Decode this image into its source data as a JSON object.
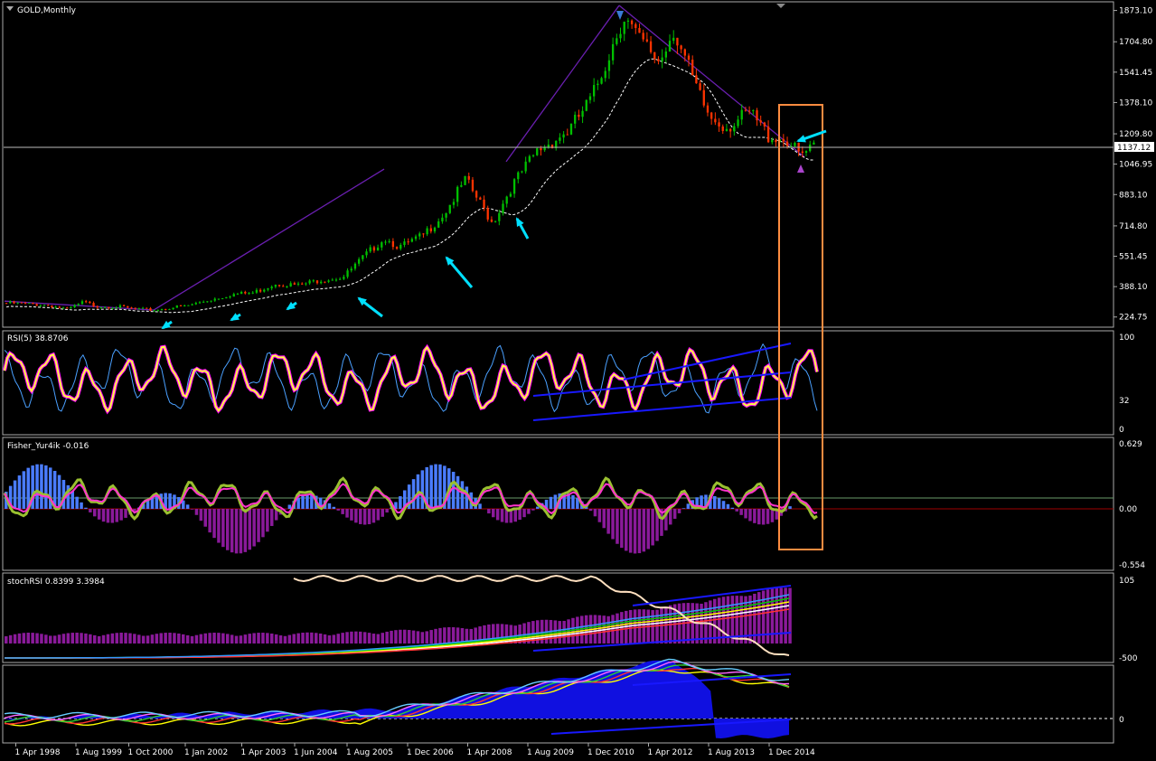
{
  "chart_data": {
    "type": "line",
    "symbol_title": "GOLD,Monthly",
    "current_price": "1137.12",
    "price_ticks": [
      "1873.10",
      "1704.80",
      "1541.45",
      "1378.10",
      "1209.80",
      "1046.95",
      "883.10",
      "714.80",
      "551.45",
      "388.10",
      "224.75"
    ],
    "price_tick_values": [
      1873.1,
      1704.8,
      1541.45,
      1378.1,
      1209.8,
      1046.95,
      883.1,
      714.8,
      551.45,
      388.1,
      224.75
    ],
    "x_ticks": [
      "1 Apr 1998",
      "1 Aug 1999",
      "1 Oct 2000",
      "1 Jan 2002",
      "1 Apr 2003",
      "1 Jun 2004",
      "1 Aug 2005",
      "1 Dec 2006",
      "1 Apr 2008",
      "1 Aug 2009",
      "1 Dec 2010",
      "1 Apr 2012",
      "1 Aug 2013",
      "1 Dec 2014"
    ],
    "x_tick_values": [
      1998.25,
      1999.58,
      2000.75,
      2002.0,
      2003.25,
      2004.42,
      2005.58,
      2006.92,
      2008.25,
      2009.58,
      2010.92,
      2012.25,
      2013.58,
      2014.92
    ],
    "price_series": [
      {
        "x": 1998.0,
        "y": 300
      },
      {
        "x": 1998.5,
        "y": 295
      },
      {
        "x": 1999.0,
        "y": 287
      },
      {
        "x": 1999.4,
        "y": 265
      },
      {
        "x": 1999.75,
        "y": 305
      },
      {
        "x": 2000.0,
        "y": 285
      },
      {
        "x": 2000.5,
        "y": 280
      },
      {
        "x": 2001.0,
        "y": 265
      },
      {
        "x": 2001.3,
        "y": 262
      },
      {
        "x": 2001.75,
        "y": 278
      },
      {
        "x": 2002.0,
        "y": 282
      },
      {
        "x": 2002.5,
        "y": 315
      },
      {
        "x": 2003.0,
        "y": 345
      },
      {
        "x": 2003.5,
        "y": 355
      },
      {
        "x": 2004.0,
        "y": 405
      },
      {
        "x": 2004.5,
        "y": 395
      },
      {
        "x": 2005.0,
        "y": 425
      },
      {
        "x": 2005.5,
        "y": 440
      },
      {
        "x": 2006.0,
        "y": 560
      },
      {
        "x": 2006.4,
        "y": 650
      },
      {
        "x": 2006.75,
        "y": 600
      },
      {
        "x": 2007.25,
        "y": 660
      },
      {
        "x": 2007.75,
        "y": 790
      },
      {
        "x": 2008.2,
        "y": 960
      },
      {
        "x": 2008.8,
        "y": 730
      },
      {
        "x": 2009.2,
        "y": 920
      },
      {
        "x": 2009.8,
        "y": 1120
      },
      {
        "x": 2010.5,
        "y": 1230
      },
      {
        "x": 2011.0,
        "y": 1400
      },
      {
        "x": 2011.7,
        "y": 1850
      },
      {
        "x": 2012.0,
        "y": 1720
      },
      {
        "x": 2012.5,
        "y": 1600
      },
      {
        "x": 2012.8,
        "y": 1780
      },
      {
        "x": 2013.3,
        "y": 1450
      },
      {
        "x": 2013.6,
        "y": 1300
      },
      {
        "x": 2014.0,
        "y": 1250
      },
      {
        "x": 2014.5,
        "y": 1320
      },
      {
        "x": 2014.9,
        "y": 1200
      },
      {
        "x": 2015.3,
        "y": 1180
      },
      {
        "x": 2015.6,
        "y": 1090
      },
      {
        "x": 2015.95,
        "y": 1137
      }
    ],
    "rsi": {
      "label": "RSI(5) 38.8706",
      "levels": [
        "100",
        "32",
        "0"
      ]
    },
    "fisher": {
      "label": "Fisher_Yur4ik -0.016",
      "levels": [
        "0.629",
        "0.00",
        "-0.554"
      ]
    },
    "stochrsi": {
      "label": "stochRSI 0.8399 3.3984",
      "levels": [
        "105",
        "-500"
      ]
    },
    "panel5": {
      "levels": [
        "0"
      ]
    },
    "colors": {
      "bull": "#00c000",
      "bear": "#ff3300",
      "ma": "#ffffff",
      "trend": "#6a1fb0",
      "arrow": "#00e0ff",
      "rsi": "#ffff40",
      "rsi_glow": "#ff00ff",
      "highlight": "#ff8c40"
    }
  }
}
